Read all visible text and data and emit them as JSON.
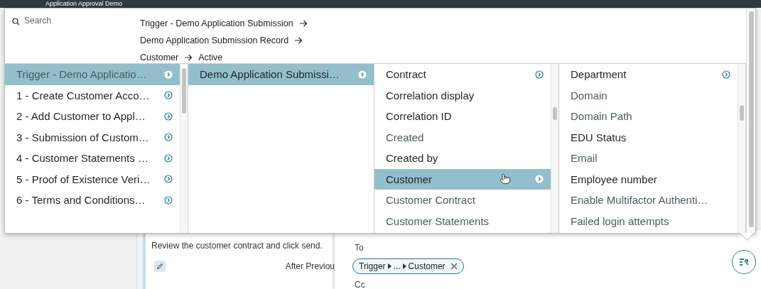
{
  "header": {
    "title": "Application Approval Demo"
  },
  "picker": {
    "search": {
      "placeholder": "Search"
    },
    "path": [
      "Trigger - Demo Application Submission",
      "Demo Application Submission Record",
      "Customer",
      "Active"
    ],
    "columns": [
      {
        "items": [
          {
            "label": "Trigger - Demo Applicatio…",
            "has_children": true,
            "selected": true,
            "muted": true
          },
          {
            "label": "1 - Create Customer Acco…",
            "has_children": true,
            "selected": false,
            "muted": false
          },
          {
            "label": "2 - Add Customer to Appl…",
            "has_children": true,
            "selected": false,
            "muted": false
          },
          {
            "label": "3 - Submission of Custom…",
            "has_children": true,
            "selected": false,
            "muted": false
          },
          {
            "label": "4 - Customer Statements …",
            "has_children": true,
            "selected": false,
            "muted": false
          },
          {
            "label": "5 - Proof of Existence Veri…",
            "has_children": true,
            "selected": false,
            "muted": false
          },
          {
            "label": "6 - Terms and Conditions…",
            "has_children": true,
            "selected": false,
            "muted": false
          }
        ]
      },
      {
        "items": [
          {
            "label": "Demo Application Submissi…",
            "has_children": true,
            "selected": true,
            "muted": false
          }
        ]
      },
      {
        "items": [
          {
            "label": "Contract",
            "has_children": true,
            "selected": false,
            "muted": false
          },
          {
            "label": "Correlation display",
            "has_children": false,
            "selected": false,
            "muted": false
          },
          {
            "label": "Correlation ID",
            "has_children": false,
            "selected": false,
            "muted": false
          },
          {
            "label": "Created",
            "has_children": false,
            "selected": false,
            "muted": true
          },
          {
            "label": "Created by",
            "has_children": false,
            "selected": false,
            "muted": false
          },
          {
            "label": "Customer",
            "has_children": true,
            "selected": true,
            "muted": false
          },
          {
            "label": "Customer Contract",
            "has_children": false,
            "selected": false,
            "muted": true
          },
          {
            "label": "Customer Statements",
            "has_children": false,
            "selected": false,
            "muted": true
          }
        ]
      },
      {
        "items": [
          {
            "label": "Department",
            "has_children": true,
            "selected": false,
            "muted": false
          },
          {
            "label": "Domain",
            "has_children": false,
            "selected": false,
            "muted": true
          },
          {
            "label": "Domain Path",
            "has_children": false,
            "selected": false,
            "muted": true
          },
          {
            "label": "EDU Status",
            "has_children": false,
            "selected": false,
            "muted": false
          },
          {
            "label": "Email",
            "has_children": false,
            "selected": false,
            "muted": true
          },
          {
            "label": "Employee number",
            "has_children": false,
            "selected": false,
            "muted": false
          },
          {
            "label": "Enable Multifactor Authenti…",
            "has_children": false,
            "selected": false,
            "muted": true
          },
          {
            "label": "Failed login attempts",
            "has_children": false,
            "selected": false,
            "muted": true
          }
        ]
      }
    ]
  },
  "card": {
    "description": "Review the customer contract and click send.",
    "timing": "After Previou"
  },
  "email": {
    "to_label": "To",
    "chip": {
      "segments": [
        "Trigger",
        "...",
        "Customer"
      ]
    },
    "cc_label": "Cc"
  }
}
